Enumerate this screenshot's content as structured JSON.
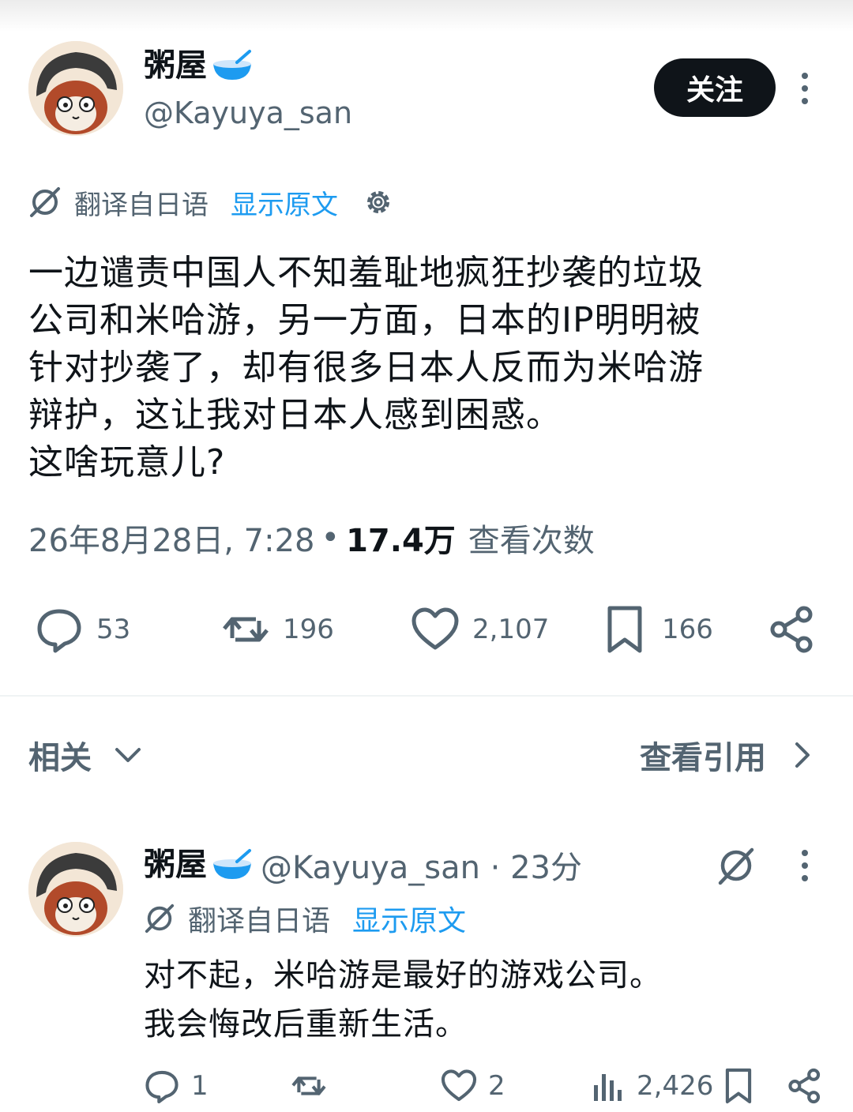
{
  "post": {
    "display_name": "粥屋",
    "handle": "@Kayuya_san",
    "follow_label": "关注",
    "translated_label": "翻译自日语",
    "show_original_label": "显示原文",
    "text": "一边谴责中国人不知羞耻地疯狂抄袭的垃圾\n公司和米哈游，另一方面，日本的IP明明被\n针对抄袭了，却有很多日本人反而为米哈游\n辩护，这让我对日本人感到困惑。\n这啥玩意儿?",
    "timestamp": "26年8月28日, 7:28",
    "separator": "•",
    "views": "17.4万",
    "views_label": "查看次数",
    "stats": {
      "replies": "53",
      "reposts": "196",
      "likes": "2,107",
      "bookmarks": "166"
    }
  },
  "section": {
    "related_label": "相关",
    "view_quotes_label": "查看引用"
  },
  "reply": {
    "display_name": "粥屋",
    "handle_time": "@Kayuya_san · 23分",
    "translated_label": "翻译自日语",
    "show_original_label": "显示原文",
    "text": "对不起，米哈游是最好的游戏公司。\n我会悔改后重新生活。",
    "stats": {
      "replies": "1",
      "likes": "2",
      "views": "2,426"
    }
  },
  "colors": {
    "text": "#0f1419",
    "secondary": "#536471",
    "link": "#1d9bf0",
    "bowl": "#1d9bf0"
  }
}
